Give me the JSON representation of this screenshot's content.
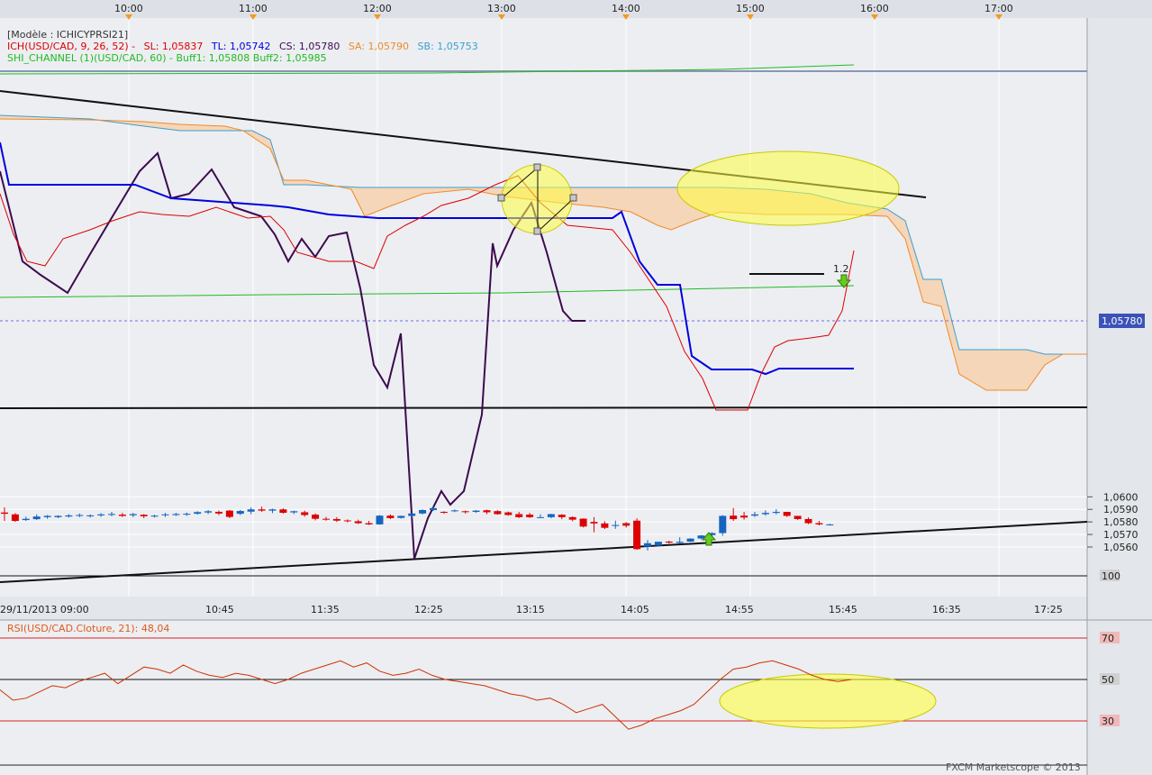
{
  "top_times": [
    "10:00",
    "11:00",
    "12:00",
    "13:00",
    "14:00",
    "15:00",
    "16:00",
    "17:00"
  ],
  "legend": {
    "model": "[Modèle : ICHICYPRSI21]",
    "ich_name": "ICH(USD/CAD, 9, 26, 52) -",
    "sl": "SL: 1,05837",
    "tl": "TL: 1,05742",
    "cs": "CS: 1,05780",
    "sa": "SA: 1,05790",
    "sb": "SB: 1,05753",
    "shi": "SHI_CHANNEL (1)(USD/CAD, 60) -  Buff1: 1,05808  Buff2: 1,05985"
  },
  "price_axis": {
    "ticks": [
      "1,0600",
      "1,0590",
      "1,0580",
      "1,0570",
      "1,0560"
    ],
    "last_price": "1,05780"
  },
  "x_axis": {
    "ticks": [
      "29/11/2013 09:00",
      "10:45",
      "11:35",
      "12:25",
      "13:15",
      "14:05",
      "14:55",
      "15:45",
      "16:35",
      "17:25"
    ]
  },
  "annotation": "1.2",
  "rsi": {
    "label": "RSI(USD/CAD.Cloture, 21): 48,04",
    "levels": [
      "100",
      "70",
      "50",
      "30"
    ]
  },
  "footer": "FXCM Marketscope © 2013",
  "colors": {
    "bull": "#1565c0",
    "bear": "#dd0000",
    "tenkan": "#dd0000",
    "kijun": "#0000dd",
    "ssa": "#f08a2a",
    "ssb": "#3aa0d0",
    "cloud": "#f5d6b8",
    "purple": "#3d0a4e",
    "shi_buff": "#22bb22",
    "highlight": "#ffff40"
  },
  "chart_data": [
    {
      "type": "candlestick",
      "symbol": "USD/CAD",
      "price_range": [
        1.05565,
        1.06045
      ],
      "candles": [
        {
          "o": 1.05875,
          "h": 1.05915,
          "c": 1.05865,
          "l": 1.05808
        },
        {
          "o": 1.0586,
          "h": 1.0587,
          "c": 1.05808,
          "l": 1.058
        },
        {
          "o": 1.05815,
          "h": 1.05842,
          "c": 1.05825,
          "l": 1.05808
        },
        {
          "o": 1.05822,
          "h": 1.0586,
          "c": 1.05843,
          "l": 1.05815
        },
        {
          "o": 1.05838,
          "h": 1.05855,
          "c": 1.05848,
          "l": 1.05825
        },
        {
          "o": 1.05838,
          "h": 1.05852,
          "c": 1.05848,
          "l": 1.0583
        },
        {
          "o": 1.05843,
          "h": 1.05862,
          "c": 1.05852,
          "l": 1.05835
        },
        {
          "o": 1.05852,
          "h": 1.05867,
          "c": 1.05855,
          "l": 1.05838
        },
        {
          "o": 1.05848,
          "h": 1.0586,
          "c": 1.05852,
          "l": 1.05835
        },
        {
          "o": 1.05852,
          "h": 1.0587,
          "c": 1.0586,
          "l": 1.0584
        },
        {
          "o": 1.0586,
          "h": 1.0588,
          "c": 1.05863,
          "l": 1.05845
        },
        {
          "o": 1.05858,
          "h": 1.05872,
          "c": 1.05848,
          "l": 1.0584
        },
        {
          "o": 1.05853,
          "h": 1.05872,
          "c": 1.05862,
          "l": 1.05838
        },
        {
          "o": 1.05857,
          "h": 1.05862,
          "c": 1.05845,
          "l": 1.0583
        },
        {
          "o": 1.05845,
          "h": 1.05857,
          "c": 1.0585,
          "l": 1.05835
        },
        {
          "o": 1.05853,
          "h": 1.05872,
          "c": 1.0586,
          "l": 1.0584
        },
        {
          "o": 1.05855,
          "h": 1.05872,
          "c": 1.05863,
          "l": 1.05848
        },
        {
          "o": 1.0586,
          "h": 1.05875,
          "c": 1.05865,
          "l": 1.05848
        },
        {
          "o": 1.05865,
          "h": 1.05885,
          "c": 1.05878,
          "l": 1.05858
        },
        {
          "o": 1.05875,
          "h": 1.05895,
          "c": 1.05885,
          "l": 1.05862
        },
        {
          "o": 1.0588,
          "h": 1.0589,
          "c": 1.05867,
          "l": 1.05855
        },
        {
          "o": 1.0589,
          "h": 1.05895,
          "c": 1.0584,
          "l": 1.0583
        },
        {
          "o": 1.05865,
          "h": 1.05895,
          "c": 1.05887,
          "l": 1.05855
        },
        {
          "o": 1.05882,
          "h": 1.05915,
          "c": 1.059,
          "l": 1.05862
        },
        {
          "o": 1.059,
          "h": 1.05922,
          "c": 1.0589,
          "l": 1.0588
        },
        {
          "o": 1.0589,
          "h": 1.05905,
          "c": 1.059,
          "l": 1.0587
        },
        {
          "o": 1.059,
          "h": 1.05908,
          "c": 1.05873,
          "l": 1.05866
        },
        {
          "o": 1.05876,
          "h": 1.0589,
          "c": 1.05885,
          "l": 1.05862
        },
        {
          "o": 1.05877,
          "h": 1.0589,
          "c": 1.05855,
          "l": 1.05842
        },
        {
          "o": 1.05858,
          "h": 1.05868,
          "c": 1.05825,
          "l": 1.05812
        },
        {
          "o": 1.05825,
          "h": 1.0584,
          "c": 1.0582,
          "l": 1.0581
        },
        {
          "o": 1.05823,
          "h": 1.05838,
          "c": 1.0581,
          "l": 1.058
        },
        {
          "o": 1.05812,
          "h": 1.0582,
          "c": 1.05805,
          "l": 1.05796
        },
        {
          "o": 1.05805,
          "h": 1.05818,
          "c": 1.0579,
          "l": 1.05783
        },
        {
          "o": 1.0579,
          "h": 1.05808,
          "c": 1.0578,
          "l": 1.05776
        },
        {
          "o": 1.0578,
          "h": 1.05855,
          "c": 1.0585,
          "l": 1.05778
        },
        {
          "o": 1.0585,
          "h": 1.0586,
          "c": 1.0583,
          "l": 1.05822
        },
        {
          "o": 1.05832,
          "h": 1.0585,
          "c": 1.05848,
          "l": 1.05826
        },
        {
          "o": 1.05848,
          "h": 1.05862,
          "c": 1.05867,
          "l": 1.05832
        },
        {
          "o": 1.05867,
          "h": 1.059,
          "c": 1.05895,
          "l": 1.0586
        },
        {
          "o": 1.05895,
          "h": 1.05922,
          "c": 1.0591,
          "l": 1.05887
        },
        {
          "o": 1.0588,
          "h": 1.05885,
          "c": 1.05875,
          "l": 1.05865
        },
        {
          "o": 1.05885,
          "h": 1.059,
          "c": 1.05892,
          "l": 1.05878
        },
        {
          "o": 1.05885,
          "h": 1.0589,
          "c": 1.0588,
          "l": 1.05866
        },
        {
          "o": 1.0588,
          "h": 1.05895,
          "c": 1.0589,
          "l": 1.05872
        },
        {
          "o": 1.05893,
          "h": 1.05898,
          "c": 1.05877,
          "l": 1.05862
        },
        {
          "o": 1.05886,
          "h": 1.05893,
          "c": 1.05862,
          "l": 1.05858
        },
        {
          "o": 1.05876,
          "h": 1.05882,
          "c": 1.05855,
          "l": 1.0585
        },
        {
          "o": 1.05862,
          "h": 1.0588,
          "c": 1.05838,
          "l": 1.05831
        },
        {
          "o": 1.05858,
          "h": 1.05872,
          "c": 1.05838,
          "l": 1.05831
        },
        {
          "o": 1.05838,
          "h": 1.0586,
          "c": 1.05838,
          "l": 1.05831
        },
        {
          "o": 1.05838,
          "h": 1.05865,
          "c": 1.05862,
          "l": 1.05829
        },
        {
          "o": 1.05857,
          "h": 1.05862,
          "c": 1.05838,
          "l": 1.05822
        },
        {
          "o": 1.05838,
          "h": 1.05845,
          "c": 1.05818,
          "l": 1.05805
        },
        {
          "o": 1.05826,
          "h": 1.05828,
          "c": 1.05763,
          "l": 1.05756
        },
        {
          "o": 1.058,
          "h": 1.05838,
          "c": 1.05788,
          "l": 1.05718
        },
        {
          "o": 1.05788,
          "h": 1.05805,
          "c": 1.05753,
          "l": 1.05743
        },
        {
          "o": 1.05768,
          "h": 1.0581,
          "c": 1.05775,
          "l": 1.05745
        },
        {
          "o": 1.0579,
          "h": 1.05798,
          "c": 1.0577,
          "l": 1.05755
        },
        {
          "o": 1.0581,
          "h": 1.05828,
          "c": 1.05583,
          "l": 1.05578
        },
        {
          "o": 1.05603,
          "h": 1.05655,
          "c": 1.0563,
          "l": 1.05572
        },
        {
          "o": 1.05611,
          "h": 1.05638,
          "c": 1.05642,
          "l": 1.05605
        },
        {
          "o": 1.05643,
          "h": 1.0565,
          "c": 1.05635,
          "l": 1.05627
        },
        {
          "o": 1.05633,
          "h": 1.05678,
          "c": 1.05642,
          "l": 1.05625
        },
        {
          "o": 1.05643,
          "h": 1.0567,
          "c": 1.05667,
          "l": 1.0564
        },
        {
          "o": 1.05668,
          "h": 1.05695,
          "c": 1.05692,
          "l": 1.0566
        },
        {
          "o": 1.05695,
          "h": 1.05718,
          "c": 1.05711,
          "l": 1.05688
        },
        {
          "o": 1.05711,
          "h": 1.05854,
          "c": 1.05848,
          "l": 1.0569
        },
        {
          "o": 1.0585,
          "h": 1.0591,
          "c": 1.05822,
          "l": 1.05808
        },
        {
          "o": 1.0585,
          "h": 1.0588,
          "c": 1.05835,
          "l": 1.05818
        },
        {
          "o": 1.0585,
          "h": 1.0588,
          "c": 1.0586,
          "l": 1.0584
        },
        {
          "o": 1.05862,
          "h": 1.05892,
          "c": 1.05872,
          "l": 1.0585
        },
        {
          "o": 1.05872,
          "h": 1.05902,
          "c": 1.0588,
          "l": 1.0586
        },
        {
          "o": 1.0588,
          "h": 1.0588,
          "c": 1.05848,
          "l": 1.0584
        },
        {
          "o": 1.05848,
          "h": 1.05848,
          "c": 1.05823,
          "l": 1.05815
        },
        {
          "o": 1.05823,
          "h": 1.05835,
          "c": 1.0579,
          "l": 1.05782
        },
        {
          "o": 1.0579,
          "h": 1.05808,
          "c": 1.0578,
          "l": 1.05772
        },
        {
          "o": 1.0578,
          "h": 1.05785,
          "c": 1.0578,
          "l": 1.05772
        }
      ]
    },
    {
      "type": "line",
      "name": "RSI",
      "ylim": [
        0,
        100
      ],
      "values": [
        45,
        40,
        41,
        44,
        47,
        46,
        49,
        51,
        53,
        48,
        52,
        56,
        55,
        53,
        57,
        54,
        52,
        51,
        53,
        52,
        50,
        48,
        50,
        53,
        55,
        57,
        59,
        56,
        58,
        54,
        52,
        53,
        55,
        52,
        50,
        49,
        48,
        47,
        45,
        43,
        42,
        40,
        41,
        38,
        34,
        36,
        38,
        32,
        26,
        28,
        31,
        33,
        35,
        38,
        44,
        50,
        55,
        56,
        58,
        59,
        57,
        55,
        52,
        50,
        49,
        50
      ]
    }
  ]
}
